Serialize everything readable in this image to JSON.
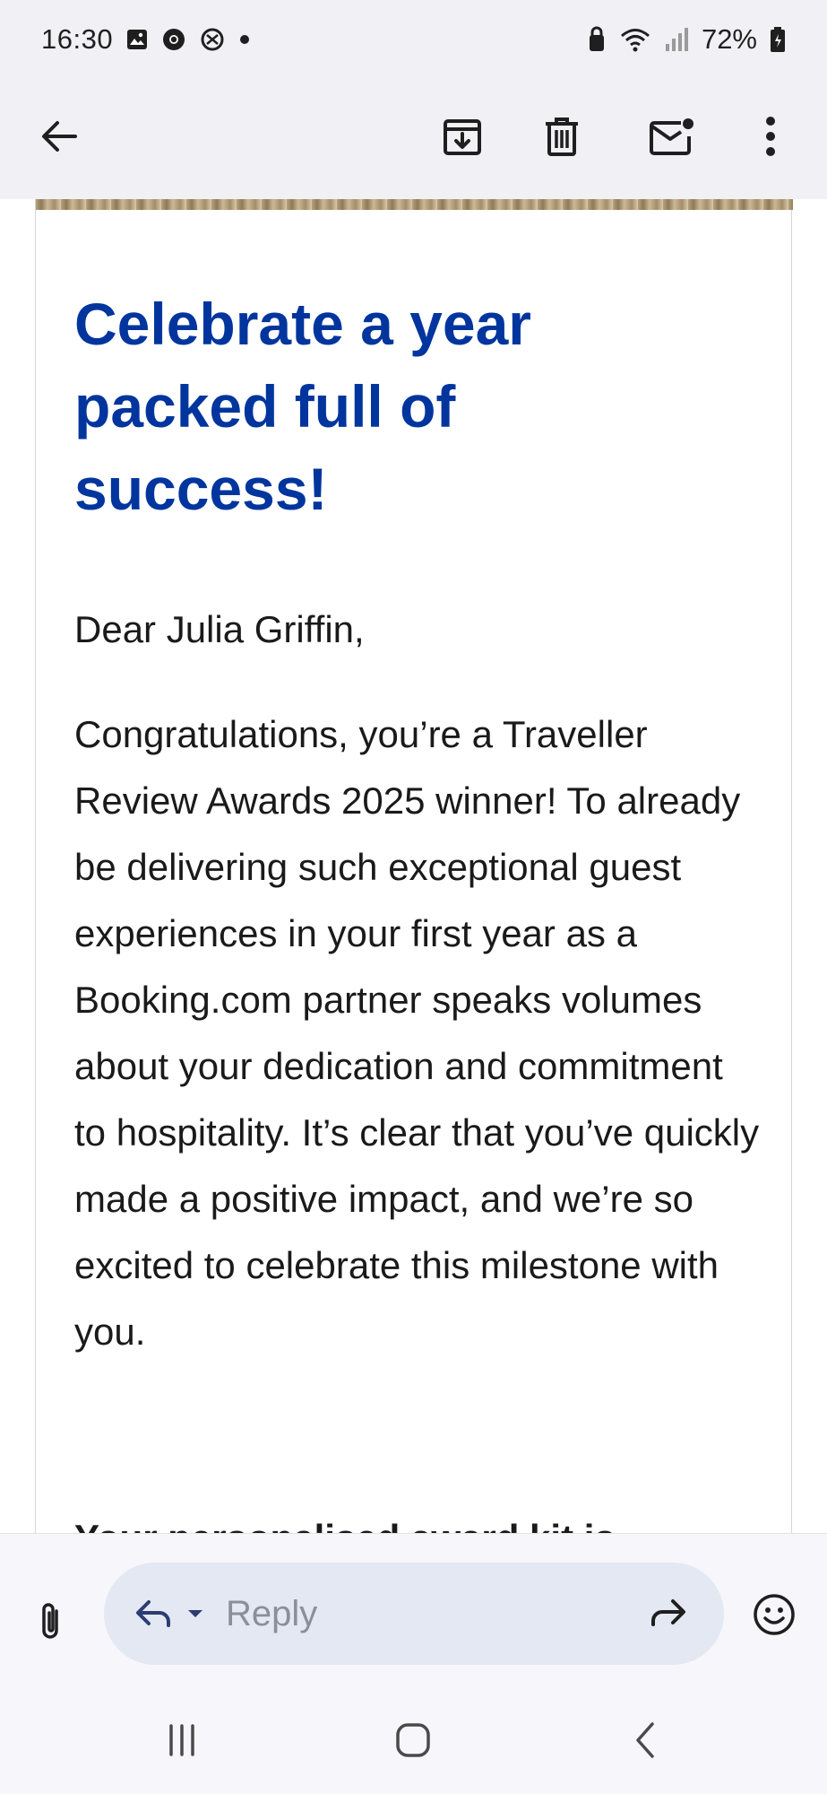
{
  "status_bar": {
    "time": "16:30",
    "battery": "72%",
    "left_icons": [
      "gallery-icon",
      "chrome-icon",
      "notification-icon",
      "dot-icon"
    ],
    "right_icons": [
      "lock-icon",
      "wifi-icon",
      "signal-icon",
      "battery-icon"
    ]
  },
  "toolbar": {
    "icons": [
      "back-arrow-icon",
      "archive-icon",
      "delete-icon",
      "mark-unread-icon",
      "more-vert-icon"
    ]
  },
  "email": {
    "headline": "Celebrate a year packed full of success!",
    "greeting": "Dear Julia Griffin,",
    "body": "Congratulations, you’re a Traveller Review Awards 2025 winner! To already be delivering such exceptional guest experiences in your first year as a Booking.com partner speaks volumes about your dedication and commitment to hospitality. It’s clear that you’ve quickly made a positive impact, and we’re so excited to celebrate this milestone with you.",
    "next_heading": "Your personalised award kit is"
  },
  "reply_bar": {
    "placeholder": "Reply",
    "icons": [
      "attachment-icon",
      "reply-icon",
      "dropdown-icon",
      "forward-icon",
      "emoji-icon"
    ]
  },
  "nav_bar": {
    "icons": [
      "recents-icon",
      "home-icon",
      "back-icon"
    ]
  },
  "colors": {
    "headline": "#00359e",
    "reply_pill": "#e4e8f2",
    "chrome_bg": "#f1f0f5"
  }
}
